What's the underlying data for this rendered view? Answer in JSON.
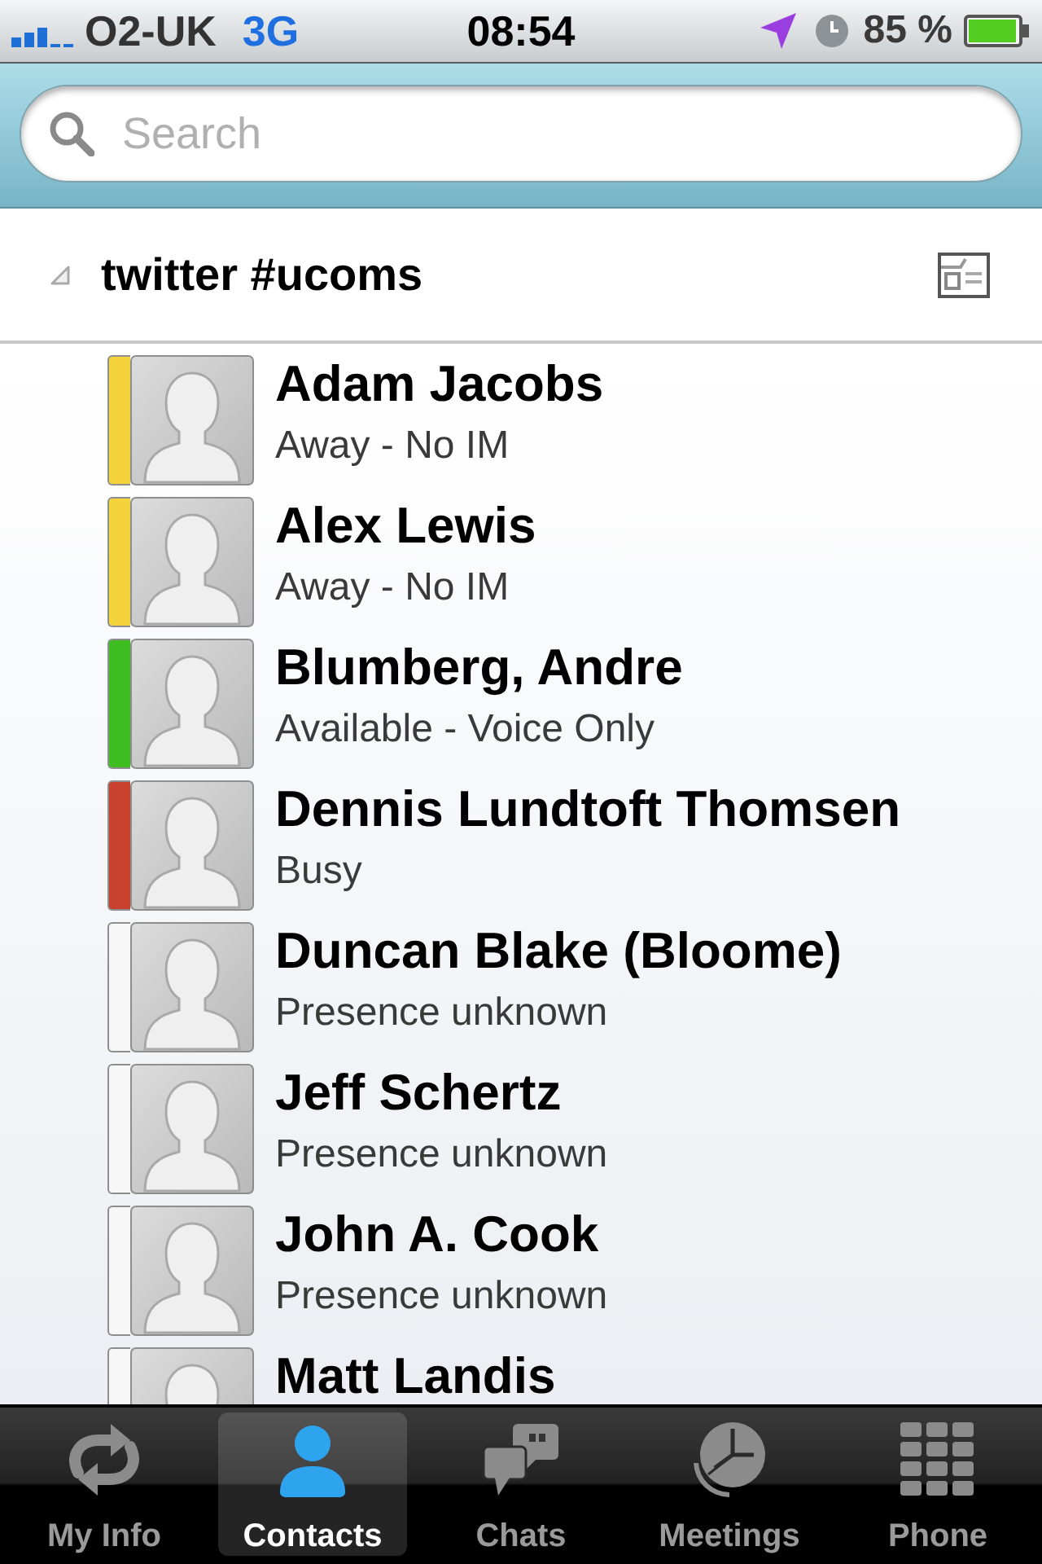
{
  "status_bar": {
    "carrier": "O2-UK",
    "network": "3G",
    "time": "08:54",
    "battery": "85 %"
  },
  "search": {
    "placeholder": "Search"
  },
  "group": {
    "title": "twitter #ucoms",
    "expanded": true
  },
  "contacts": [
    {
      "name": "Adam Jacobs",
      "status": "Away - No IM",
      "color": "#f5d33c"
    },
    {
      "name": "Alex Lewis",
      "status": "Away - No IM",
      "color": "#f5d33c"
    },
    {
      "name": "Blumberg, Andre",
      "status": "Available - Voice Only",
      "color": "#3dbd1f"
    },
    {
      "name": "Dennis Lundtoft Thomsen",
      "status": "Busy",
      "color": "#c8402e"
    },
    {
      "name": "Duncan Blake (Bloome)",
      "status": "Presence unknown",
      "color": "#f7f7f7"
    },
    {
      "name": "Jeff Schertz",
      "status": "Presence unknown",
      "color": "#f7f7f7"
    },
    {
      "name": "John A. Cook",
      "status": "Presence unknown",
      "color": "#f7f7f7"
    },
    {
      "name": "Matt Landis",
      "color": "#f7f7f7"
    }
  ],
  "tabs": [
    {
      "label": "My Info",
      "selected": false
    },
    {
      "label": "Contacts",
      "selected": true
    },
    {
      "label": "Chats",
      "selected": false
    },
    {
      "label": "Meetings",
      "selected": false
    },
    {
      "label": "Phone",
      "selected": false
    }
  ]
}
